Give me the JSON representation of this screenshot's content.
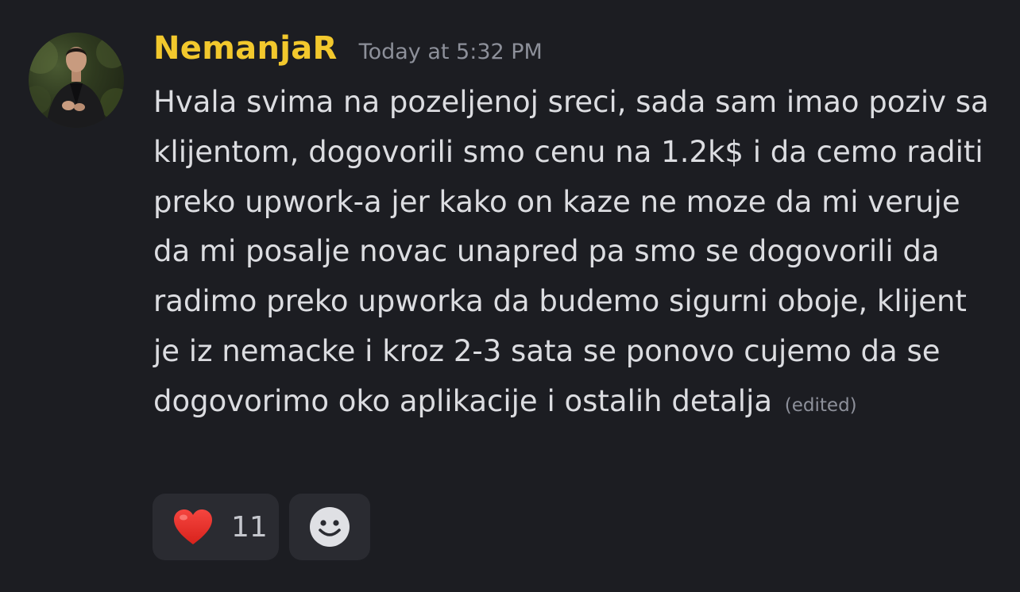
{
  "message": {
    "username": "NemanjaR",
    "timestamp": "Today at 5:32 PM",
    "content": "Hvala svima na pozeljenoj sreci, sada sam imao poziv sa klijentom, dogovorili smo cenu na 1.2k$ i da cemo raditi preko upwork-a jer kako on kaze ne moze da mi veruje da mi posalje novac unapred pa smo se dogovorili da radimo preko upworka da budemo sigurni oboje, klijent je iz nemacke i kroz 2-3 sata se ponovo cujemo da se dogovorimo oko aplikacije i ostalih detalja",
    "edited_label": "(edited)",
    "avatar_icon": "user-avatar-photo"
  },
  "reactions": [
    {
      "emoji": "red-heart",
      "count": "11"
    }
  ],
  "add_reaction_icon": "smiley-face-icon",
  "colors": {
    "background": "#1c1d22",
    "username": "#f2c82d",
    "text": "#dcdde1",
    "muted": "#8d909a",
    "reaction_bg": "#2a2b31"
  }
}
